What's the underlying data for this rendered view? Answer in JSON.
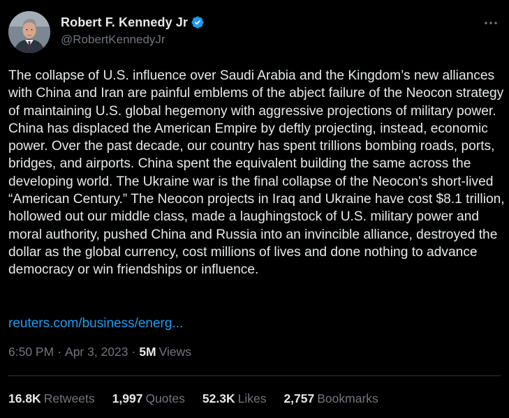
{
  "author": {
    "display_name": "Robert F. Kennedy Jr",
    "handle": "@RobertKennedyJr",
    "verified": true,
    "verified_color": "#1d9bf0"
  },
  "tweet": {
    "text": "The collapse of U.S. influence over Saudi Arabia and the Kingdom’s new alliances with China and Iran are painful emblems of the abject failure of the Neocon strategy of maintaining U.S. global hegemony with aggressive projections of military power. China has displaced the American Empire by deftly projecting, instead, economic power. Over the past decade, our country has spent trillions bombing roads, ports, bridges, and airports. China spent the equivalent building the same across the developing world. The Ukraine war is the final collapse of the Neocon's short-lived “American Century.” The Neocon projects in Iraq and Ukraine have cost $8.1 trillion, hollowed out our middle class, made a laughingstock of U.S. military power and moral authority, pushed China and Russia into an invincible alliance, destroyed the dollar as the global currency, cost millions of lives and done nothing to advance democracy or win friendships or influence.",
    "link_text": "reuters.com/business/energ...",
    "link_color": "#1d9bf0"
  },
  "meta": {
    "time": "6:50 PM",
    "date": "Apr 3, 2023",
    "separator": "·",
    "views_count": "5M",
    "views_label": "Views"
  },
  "stats": {
    "retweets_count": "16.8K",
    "retweets_label": "Retweets",
    "quotes_count": "1,997",
    "quotes_label": "Quotes",
    "likes_count": "52.3K",
    "likes_label": "Likes",
    "bookmarks_count": "2,757",
    "bookmarks_label": "Bookmarks"
  },
  "icons": {
    "more": "more-horizontal-icon",
    "verified": "verified-badge-icon"
  },
  "colors": {
    "background": "#000000",
    "text_primary": "#e7e9ea",
    "text_secondary": "#71767b",
    "divider": "#2f3336"
  }
}
